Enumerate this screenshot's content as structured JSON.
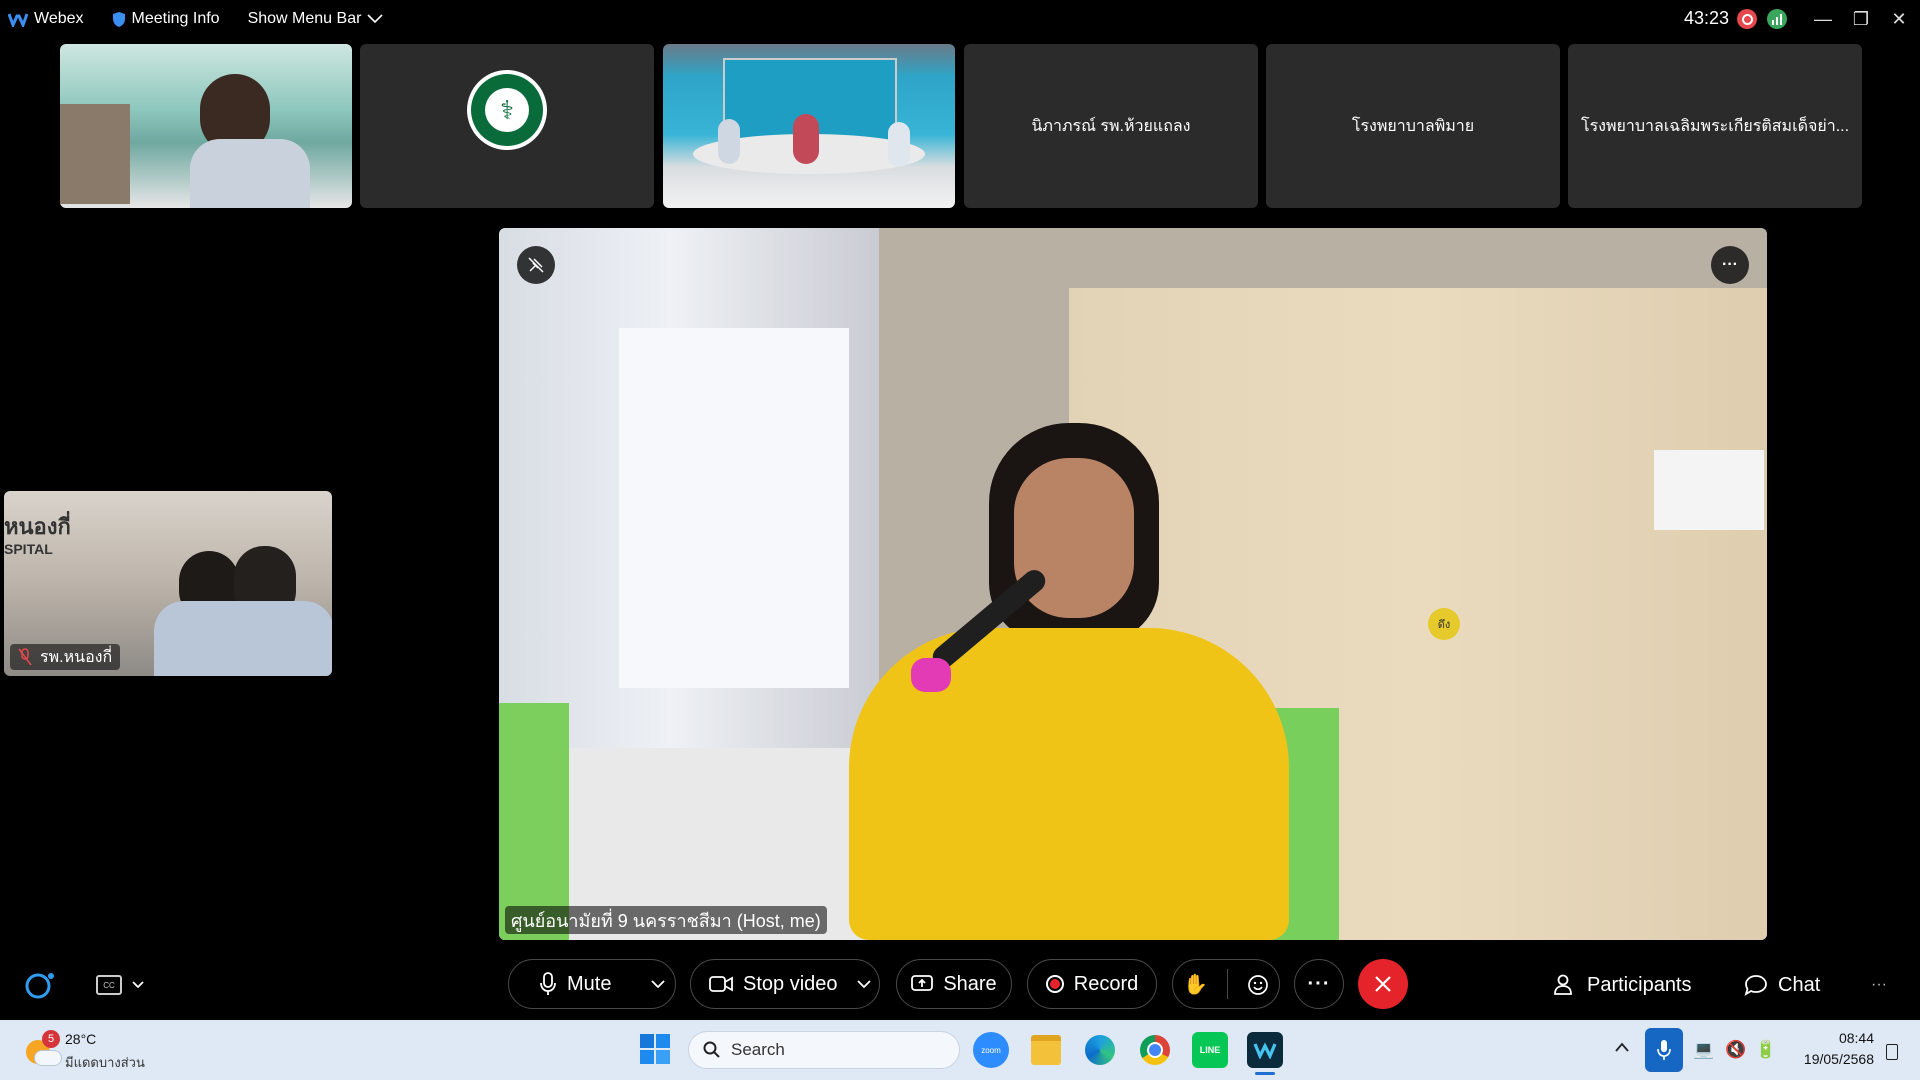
{
  "titlebar": {
    "app": "Webex",
    "meeting_info": "Meeting Info",
    "show_menu_bar": "Show Menu Bar",
    "timer": "43:23"
  },
  "thumbnails": [
    {
      "type": "video",
      "label": ""
    },
    {
      "type": "logo",
      "label": ""
    },
    {
      "type": "video",
      "label": ""
    },
    {
      "type": "name",
      "label": "นิภาภรณ์ รพ.ห้วยแถลง"
    },
    {
      "type": "name",
      "label": "โรงพยาบาลพิมาย"
    },
    {
      "type": "name",
      "label": "โรงพยาบาลเฉลิมพระเกียรติสมเด็จย่า..."
    }
  ],
  "self_view": {
    "sign_text_1": "หนองกี่",
    "sign_text_2": "SPITAL",
    "name": "รพ.หนองกี่"
  },
  "main_video": {
    "speaker_label": "ศูนย์อนามัยที่ 9 นครราชสีมา (Host, me)",
    "door_sign": "ดึง"
  },
  "toolbar": {
    "mute": "Mute",
    "stop_video": "Stop video",
    "share": "Share",
    "record": "Record",
    "participants": "Participants",
    "chat": "Chat"
  },
  "taskbar": {
    "weather_temp": "28°C",
    "weather_desc": "มีแดดบางส่วน",
    "weather_badge": "5",
    "search_placeholder": "Search",
    "time": "08:44",
    "date": "19/05/2568"
  },
  "colors": {
    "end_button": "#e5232b",
    "accent": "#1b6ef3",
    "taskbar_bg": "#dfe9f5",
    "tile_bg": "#2b2b2b"
  }
}
